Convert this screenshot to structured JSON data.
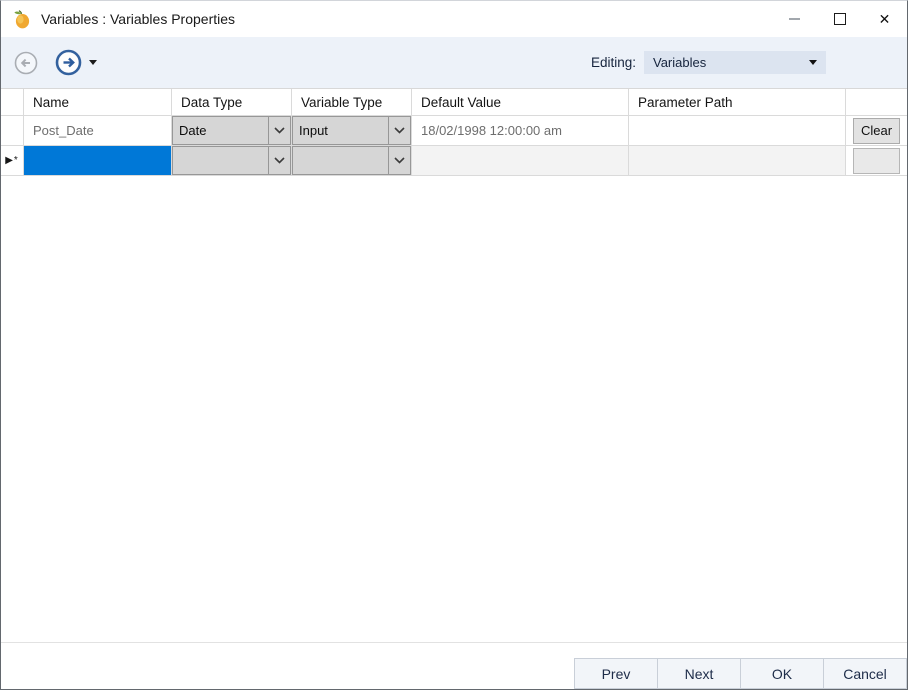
{
  "window": {
    "title": "Variables : Variables Properties"
  },
  "icons": {
    "app_icon": "mango-fruit-icon",
    "minimize": "horizontal-dash",
    "maximize": "square-outline",
    "close_glyph": "✕",
    "back": "left-arrow-in-circle",
    "forward": "right-arrow-in-circle",
    "dropdown_caret": "down-triangle",
    "combo_chevron": "chevron-down"
  },
  "toolbar": {
    "editing_label": "Editing:",
    "editing_value": "Variables"
  },
  "table": {
    "columns": [
      "",
      "Name",
      "Data Type",
      "Variable Type",
      "Default Value",
      "Parameter Path",
      ""
    ],
    "rows": [
      {
        "row_indicator": "",
        "name": "Post_Date",
        "data_type": "Date",
        "variable_type": "Input",
        "default_value": "18/02/1998 12:00:00 am",
        "parameter_path": "",
        "action_label": "Clear"
      },
      {
        "row_indicator": "▶*",
        "name": "",
        "data_type": "",
        "variable_type": "",
        "default_value": "",
        "parameter_path": "",
        "action_label": ""
      }
    ]
  },
  "footer": {
    "buttons": [
      "Prev",
      "Next",
      "OK",
      "Cancel"
    ]
  },
  "colors": {
    "selected_cell_blue": "#0078d7",
    "nav_forward_blue": "#2d5c9d",
    "toolbar_background": "#edf2f9",
    "combo_fill": "#d6d6d6",
    "editing_select_fill": "#dce4f0"
  }
}
